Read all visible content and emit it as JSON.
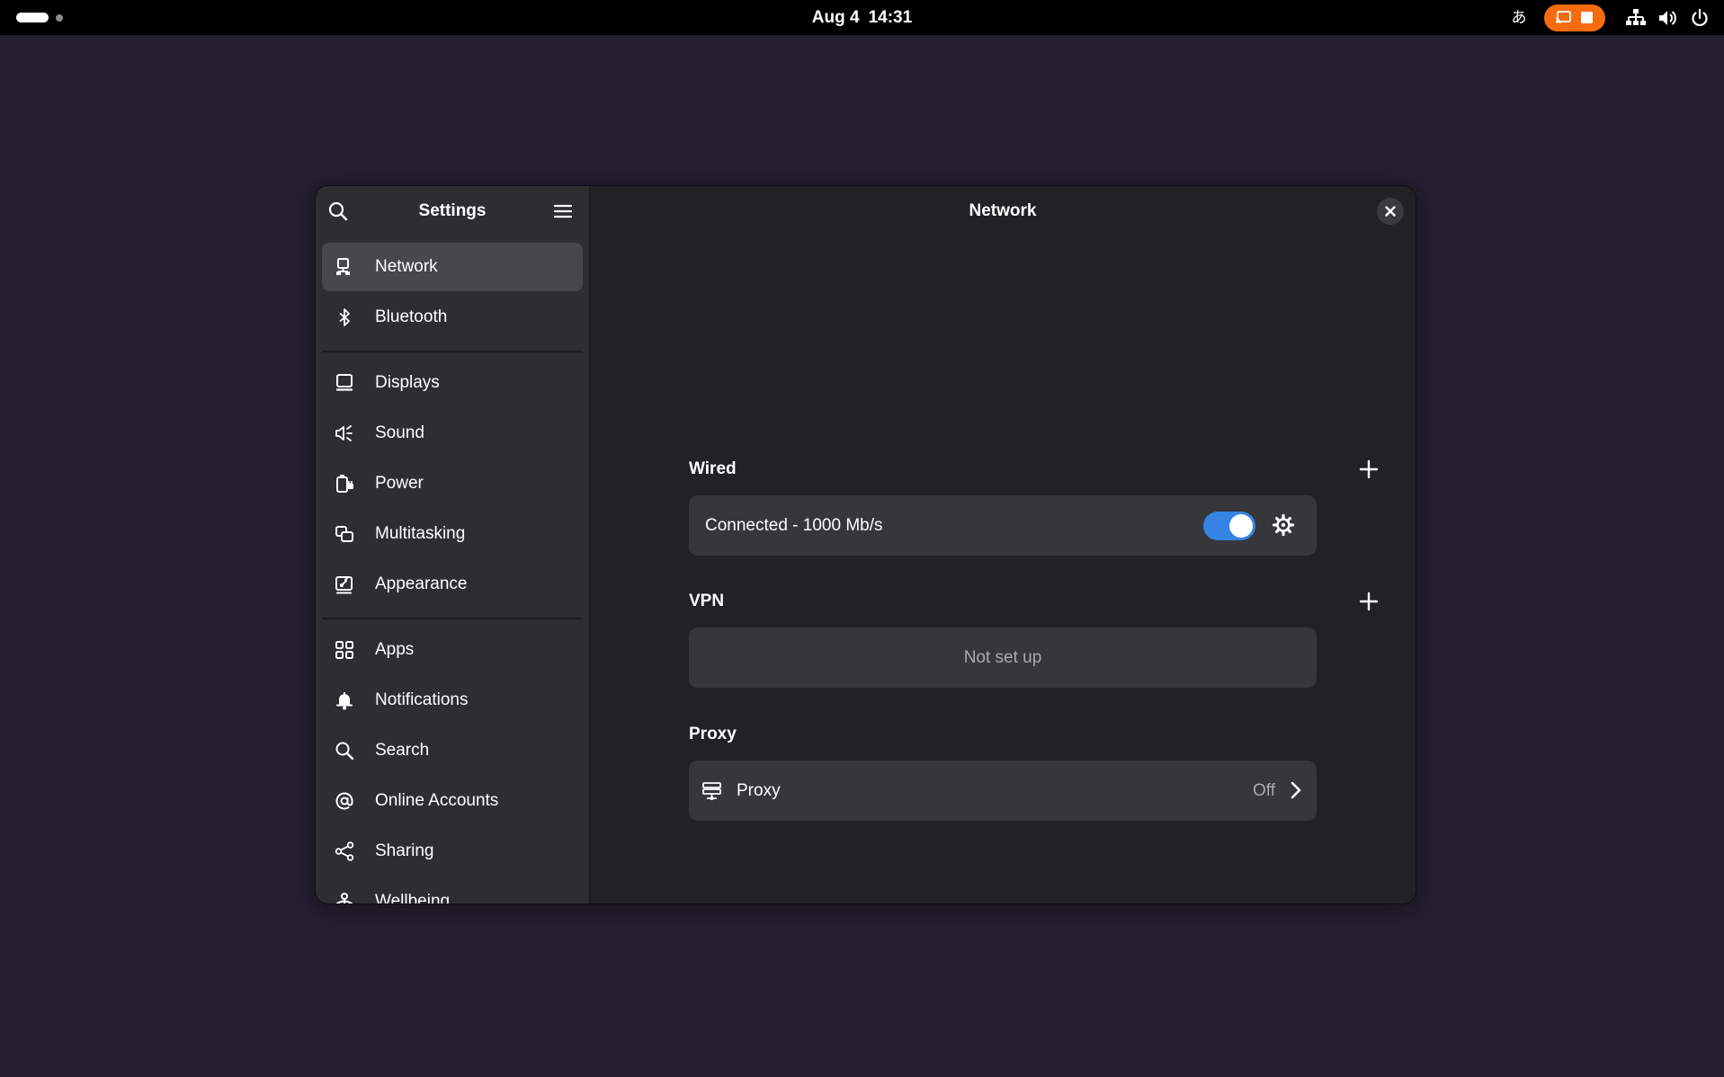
{
  "topbar": {
    "date": "Aug 4",
    "time": "14:31",
    "input_method": "あ",
    "icons": [
      "activities-indicator",
      "input-method-icon",
      "screencast-icon",
      "stop-recording-icon",
      "wired-network-icon",
      "volume-icon",
      "power-icon"
    ],
    "accent": "#f66b0e"
  },
  "sidebar": {
    "title": "Settings",
    "items": [
      {
        "label": "Network",
        "icon": "network-wired-icon",
        "selected": true
      },
      {
        "label": "Bluetooth",
        "icon": "bluetooth-icon"
      },
      {
        "label": "Displays",
        "icon": "display-icon"
      },
      {
        "label": "Sound",
        "icon": "sound-icon"
      },
      {
        "label": "Power",
        "icon": "power-plug-icon"
      },
      {
        "label": "Multitasking",
        "icon": "multitasking-icon"
      },
      {
        "label": "Appearance",
        "icon": "appearance-icon"
      },
      {
        "label": "Apps",
        "icon": "apps-grid-icon"
      },
      {
        "label": "Notifications",
        "icon": "bell-icon"
      },
      {
        "label": "Search",
        "icon": "search-icon"
      },
      {
        "label": "Online Accounts",
        "icon": "at-sign-icon"
      },
      {
        "label": "Sharing",
        "icon": "share-icon"
      },
      {
        "label": "Wellbeing",
        "icon": "wellbeing-icon"
      }
    ]
  },
  "content": {
    "title": "Network",
    "wired": {
      "title": "Wired",
      "status": "Connected - 1000 Mb/s",
      "enabled": true
    },
    "vpn": {
      "title": "VPN",
      "empty_text": "Not set up"
    },
    "proxy": {
      "title": "Proxy",
      "label": "Proxy",
      "value": "Off"
    }
  },
  "colors": {
    "desktop": "#241f31",
    "toggle_on": "#3584e4"
  }
}
